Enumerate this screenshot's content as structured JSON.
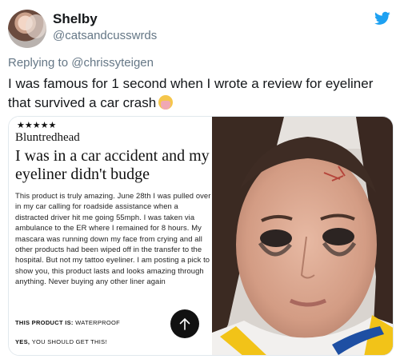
{
  "user": {
    "display_name": "Shelby",
    "handle": "@catsandcusswrds"
  },
  "reply": {
    "prefix": "Replying to",
    "mention": "@chrissyteigen"
  },
  "tweet": {
    "text": "I was famous for 1 second when I wrote a review for eyeliner that survived a car crash",
    "emoji": "woman-gesturing-emoji"
  },
  "review": {
    "stars": "★★★★★",
    "reviewer": "Bluntredhead",
    "title": "I was in a car accident and my eyeliner didn't budge",
    "body": "This product is truly amazing. June 28th I was pulled over in my car calling for roadside assistance when a distracted driver hit me going 55mph. I was taken via ambulance to the ER where I remained for 8 hours. My mascara was running down my face from crying and all other products had been wiped off in the transfer to the hospital. But not my tattoo eyeliner. I am posting a pick to show you, this product lasts and looks amazing through anything. Never buying any other liner again",
    "spec_label": "THIS PRODUCT IS:",
    "spec_value": "WATERPROOF",
    "recommend_label": "YES,",
    "recommend_value": "YOU SHOULD GET THIS!"
  },
  "icons": {
    "brand": "twitter-bird-icon",
    "scroll": "arrow-up-icon"
  },
  "colors": {
    "brand": "#1da1f2",
    "secondary_text": "#657786",
    "text": "#14171a"
  }
}
